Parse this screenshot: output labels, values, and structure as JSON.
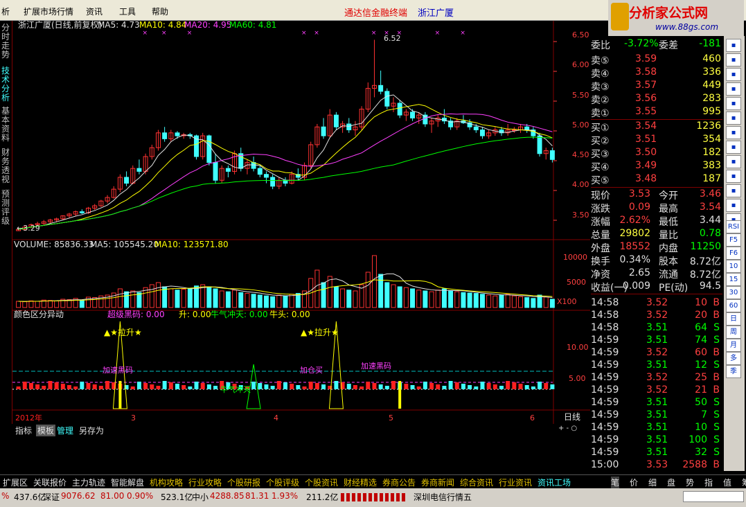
{
  "menu": {
    "items": [
      "析",
      "扩展市场行情",
      "资讯",
      "工具",
      "帮助"
    ],
    "title1": "通达信金融终端",
    "title2": "浙江广厦"
  },
  "logo": {
    "text": "分析家公式网",
    "url": "www.88gs.com"
  },
  "vtabs": [
    "分时走势",
    "技术分析",
    "基本资料",
    "财务透视",
    "预测评级"
  ],
  "price_panel": {
    "header": "浙江广厦(日线,前复权)",
    "ma5": "MA5: 4.73",
    "ma10": "MA10: 4.84",
    "ma20": "MA20: 4.95",
    "ma60": "MA60: 4.81",
    "high_label": "6.52",
    "low_label": "←3.29",
    "yticks": [
      "6.50",
      "6.00",
      "5.50",
      "5.00",
      "4.50",
      "4.00",
      "3.50"
    ]
  },
  "vol_panel": {
    "header": "VOLUME: 85836.33",
    "ma5": "MA5: 105545.20",
    "ma10": "MA10: 123571.80",
    "yticks": [
      "10000",
      "5000"
    ],
    "unit": "X100"
  },
  "ind_panel": {
    "title": "颜色区分异动",
    "l1": "超级黑码: 0.00",
    "l2": "升: 0.00",
    "l3": "牛气冲天: 0.00",
    "l4": "牛头: 0.00",
    "sig1": "▲★拉升★",
    "sig2": "▲★拉升★",
    "sig3": "加速黑码",
    "sig4": "加仓买",
    "sig5": "加速黑码",
    "sig6": "牛气冲天",
    "yticks": [
      "10.00",
      "5.00"
    ]
  },
  "xaxis": {
    "labels": [
      "2012年",
      "3",
      "4",
      "5",
      "6"
    ],
    "period": "日线"
  },
  "chart_data": {
    "type": "candlestick",
    "title": "浙江广厦(日线,前复权)",
    "ylim": [
      3.2,
      6.7
    ],
    "candles": [
      [
        3.3,
        3.35,
        3.3,
        3.32
      ],
      [
        3.32,
        3.38,
        3.3,
        3.36
      ],
      [
        3.36,
        3.42,
        3.34,
        3.4
      ],
      [
        3.4,
        3.45,
        3.38,
        3.42
      ],
      [
        3.42,
        3.48,
        3.4,
        3.45
      ],
      [
        3.45,
        3.5,
        3.42,
        3.48
      ],
      [
        3.48,
        3.52,
        3.44,
        3.5
      ],
      [
        3.5,
        3.56,
        3.48,
        3.55
      ],
      [
        3.55,
        3.6,
        3.52,
        3.58
      ],
      [
        3.58,
        3.64,
        3.55,
        3.62
      ],
      [
        3.62,
        3.66,
        3.58,
        3.6
      ],
      [
        3.6,
        3.7,
        3.58,
        3.68
      ],
      [
        3.68,
        3.75,
        3.65,
        3.72
      ],
      [
        3.72,
        3.82,
        3.7,
        3.8
      ],
      [
        3.8,
        3.9,
        3.76,
        3.86
      ],
      [
        3.86,
        4.05,
        3.84,
        4.0
      ],
      [
        4.0,
        4.25,
        3.95,
        4.2
      ],
      [
        4.2,
        4.3,
        4.05,
        4.1
      ],
      [
        4.1,
        4.4,
        4.08,
        4.35
      ],
      [
        4.35,
        4.5,
        4.25,
        4.3
      ],
      [
        4.3,
        4.6,
        4.25,
        4.55
      ],
      [
        4.55,
        4.75,
        4.5,
        4.7
      ],
      [
        4.7,
        5.0,
        4.65,
        4.95
      ],
      [
        4.95,
        5.05,
        4.8,
        4.85
      ],
      [
        4.85,
        5.0,
        4.8,
        4.95
      ],
      [
        4.95,
        4.98,
        4.85,
        4.9
      ],
      [
        4.9,
        4.95,
        4.85,
        4.92
      ],
      [
        4.92,
        4.95,
        4.85,
        4.9
      ],
      [
        4.9,
        4.92,
        4.5,
        4.55
      ],
      [
        4.55,
        4.95,
        4.5,
        4.9
      ],
      [
        4.9,
        4.92,
        4.4,
        4.45
      ],
      [
        4.45,
        4.6,
        4.1,
        4.15
      ],
      [
        4.15,
        4.4,
        4.1,
        4.35
      ],
      [
        4.35,
        4.4,
        4.2,
        4.3
      ],
      [
        4.3,
        4.65,
        4.25,
        4.6
      ],
      [
        4.6,
        4.7,
        4.3,
        4.35
      ],
      [
        4.35,
        4.5,
        4.25,
        4.45
      ],
      [
        4.45,
        4.55,
        4.3,
        4.35
      ],
      [
        4.35,
        4.4,
        4.2,
        4.25
      ],
      [
        4.25,
        4.3,
        4.1,
        4.2
      ],
      [
        4.2,
        4.25,
        4.0,
        4.05
      ],
      [
        4.05,
        4.2,
        4.0,
        4.15
      ],
      [
        4.15,
        4.2,
        4.05,
        4.1
      ],
      [
        4.1,
        4.3,
        4.08,
        4.25
      ],
      [
        4.25,
        4.35,
        4.15,
        4.2
      ],
      [
        4.2,
        4.45,
        4.15,
        4.4
      ],
      [
        4.4,
        4.8,
        4.35,
        4.75
      ],
      [
        4.75,
        5.1,
        4.7,
        5.05
      ],
      [
        5.05,
        5.2,
        4.85,
        4.9
      ],
      [
        4.9,
        5.35,
        4.88,
        5.25
      ],
      [
        5.25,
        5.3,
        5.0,
        5.05
      ],
      [
        5.05,
        5.15,
        4.95,
        5.1
      ],
      [
        5.1,
        5.2,
        4.95,
        5.0
      ],
      [
        5.0,
        5.15,
        4.9,
        5.05
      ],
      [
        5.05,
        5.4,
        5.0,
        5.35
      ],
      [
        5.35,
        5.8,
        5.3,
        5.7
      ],
      [
        5.7,
        6.52,
        5.55,
        5.75
      ],
      [
        5.75,
        6.0,
        5.6,
        5.65
      ],
      [
        5.65,
        5.7,
        5.35,
        5.4
      ],
      [
        5.4,
        5.55,
        5.3,
        5.45
      ],
      [
        5.45,
        5.5,
        5.2,
        5.25
      ],
      [
        5.25,
        5.35,
        5.15,
        5.3
      ],
      [
        5.3,
        5.35,
        5.15,
        5.2
      ],
      [
        5.2,
        5.3,
        5.1,
        5.25
      ],
      [
        5.25,
        5.3,
        5.05,
        5.1
      ],
      [
        5.1,
        5.2,
        4.95,
        5.15
      ],
      [
        5.15,
        5.25,
        5.05,
        5.2
      ],
      [
        5.2,
        5.35,
        5.1,
        5.15
      ],
      [
        5.15,
        5.2,
        5.0,
        5.05
      ],
      [
        5.05,
        5.2,
        5.0,
        5.15
      ],
      [
        5.15,
        5.25,
        5.1,
        5.12
      ],
      [
        5.12,
        5.18,
        5.0,
        5.05
      ],
      [
        5.05,
        5.1,
        4.95,
        5.0
      ],
      [
        5.0,
        5.05,
        4.85,
        4.9
      ],
      [
        4.9,
        5.0,
        4.85,
        4.95
      ],
      [
        4.95,
        5.05,
        4.9,
        5.0
      ],
      [
        5.0,
        5.05,
        4.9,
        4.95
      ],
      [
        4.95,
        5.1,
        4.9,
        5.0
      ],
      [
        5.0,
        5.05,
        4.95,
        5.0
      ],
      [
        5.0,
        5.1,
        4.95,
        5.05
      ],
      [
        5.05,
        5.1,
        4.95,
        5.0
      ],
      [
        5.0,
        5.05,
        4.85,
        4.9
      ],
      [
        4.9,
        4.95,
        4.55,
        4.6
      ],
      [
        4.6,
        4.7,
        4.5,
        4.65
      ],
      [
        4.65,
        4.7,
        4.45,
        4.5
      ]
    ],
    "volume": [
      15,
      14,
      16,
      15,
      18,
      17,
      16,
      20,
      19,
      22,
      18,
      25,
      24,
      28,
      30,
      35,
      45,
      38,
      40,
      36,
      48,
      55,
      60,
      50,
      45,
      42,
      44,
      46,
      52,
      55,
      50,
      45,
      40,
      38,
      42,
      36,
      34,
      32,
      30,
      28,
      26,
      30,
      28,
      32,
      34,
      40,
      70,
      90,
      60,
      75,
      50,
      45,
      42,
      40,
      55,
      85,
      125,
      80,
      60,
      55,
      50,
      48,
      45,
      42,
      40,
      38,
      42,
      45,
      40,
      38,
      36,
      35,
      34,
      32,
      30,
      28,
      30,
      32,
      28,
      26,
      24,
      22,
      30,
      25,
      20
    ]
  },
  "quote": {
    "weibi_l": "委比",
    "weibi_v": "-3.72%",
    "weicha_l": "委差",
    "weicha_v": "-181",
    "asks": [
      {
        "l": "卖⑤",
        "p": "3.59",
        "v": "460"
      },
      {
        "l": "卖④",
        "p": "3.58",
        "v": "336"
      },
      {
        "l": "卖③",
        "p": "3.57",
        "v": "449"
      },
      {
        "l": "卖②",
        "p": "3.56",
        "v": "283"
      },
      {
        "l": "卖①",
        "p": "3.55",
        "v": "995"
      }
    ],
    "bids": [
      {
        "l": "买①",
        "p": "3.54",
        "v": "1236"
      },
      {
        "l": "买②",
        "p": "3.51",
        "v": "354"
      },
      {
        "l": "买③",
        "p": "3.50",
        "v": "182"
      },
      {
        "l": "买④",
        "p": "3.49",
        "v": "383"
      },
      {
        "l": "买⑤",
        "p": "3.48",
        "v": "187"
      }
    ],
    "stats": [
      [
        "现价",
        "3.53",
        "今开",
        "3.46"
      ],
      [
        "涨跌",
        "0.09",
        "最高",
        "3.54"
      ],
      [
        "涨幅",
        "2.62%",
        "最低",
        "3.44"
      ],
      [
        "总量",
        "29802",
        "量比",
        "0.78"
      ],
      [
        "外盘",
        "18552",
        "内盘",
        "11250"
      ],
      [
        "换手",
        "0.34%",
        "股本",
        "8.72亿"
      ],
      [
        "净资",
        "2.65",
        "流通",
        "8.72亿"
      ],
      [
        "收益(一)",
        "0.009",
        "PE(动)",
        "94.5"
      ]
    ],
    "ticks": [
      [
        "14:58",
        "3.52",
        "10",
        "B"
      ],
      [
        "14:58",
        "3.52",
        "20",
        "B"
      ],
      [
        "14:58",
        "3.51",
        "64",
        "S"
      ],
      [
        "14:59",
        "3.51",
        "74",
        "S"
      ],
      [
        "14:59",
        "3.52",
        "60",
        "B"
      ],
      [
        "14:59",
        "3.51",
        "12",
        "S"
      ],
      [
        "14:59",
        "3.52",
        "25",
        "B"
      ],
      [
        "14:59",
        "3.52",
        "21",
        "B"
      ],
      [
        "14:59",
        "3.51",
        "50",
        "S"
      ],
      [
        "14:59",
        "3.51",
        "7",
        "S"
      ],
      [
        "14:59",
        "3.51",
        "10",
        "S"
      ],
      [
        "14:59",
        "3.51",
        "100",
        "S"
      ],
      [
        "14:59",
        "3.51",
        "32",
        "S"
      ],
      [
        "15:00",
        "3.53",
        "2588",
        "B"
      ]
    ]
  },
  "ricons": [
    "RSI",
    "F5",
    "F6",
    "10",
    "15",
    "30",
    "60",
    "日",
    "周",
    "月",
    "多",
    "季"
  ],
  "btmtabs": [
    "指标",
    "模板",
    "管理",
    "另存为"
  ],
  "navbar": [
    "扩展区",
    "关联报价",
    "主力轨迹",
    "智能解盘",
    "机构攻略",
    "行业攻略",
    "个股研报",
    "个股评级",
    "个股资讯",
    "财经精选",
    "券商公告",
    "券商新闻",
    "综合资讯",
    "行业资讯",
    "资讯工场",
    "笔",
    "价",
    "细",
    "盘",
    "势",
    "指",
    "值",
    "筹"
  ],
  "status": {
    "a": "%",
    "b": "437.6亿",
    "c": "深证",
    "d": "9076.62",
    "e": "81.00",
    "f": "0.90%",
    "g": "523.1亿",
    "h": "中小",
    "i": "4288.85",
    "j": "81.31",
    "k": "1.93%",
    "l": "211.2亿",
    "m": "深圳电信行情五"
  },
  "colors": {
    "up": "#ff3232",
    "down": "#40ffff",
    "ma5": "#e0e0e0",
    "ma10": "#ffff00",
    "ma20": "#ff40ff",
    "ma60": "#00ff00"
  }
}
